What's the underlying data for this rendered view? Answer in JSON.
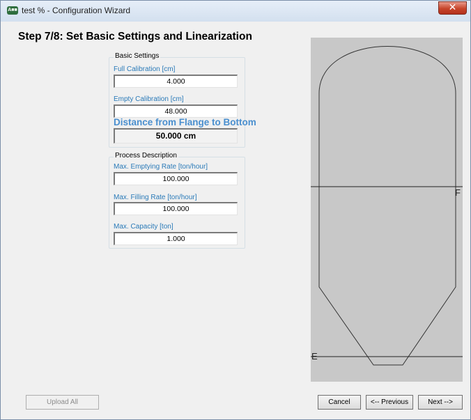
{
  "window": {
    "title": "test % - Configuration Wizard",
    "icon_text": "A■■",
    "close_icon": "✕"
  },
  "step_title": "Step 7/8: Set Basic Settings and Linearization",
  "basic_settings": {
    "legend": "Basic Settings",
    "full_calibration_label": "Full Calibration [cm]",
    "full_calibration_value": "4.000",
    "empty_calibration_label": "Empty Calibration [cm]",
    "empty_calibration_value": "48.000",
    "distance_label": "Distance from Flange to Bottom",
    "distance_value": "50.000 cm"
  },
  "process_description": {
    "legend": "Process Description",
    "max_emptying_label": "Max. Emptying Rate [ton/hour]",
    "max_emptying_value": "100.000",
    "max_filling_label": "Max. Filling Rate  [ton/hour]",
    "max_filling_value": "100.000",
    "max_capacity_label": "Max. Capacity [ton]",
    "max_capacity_value": "1.000"
  },
  "diagram": {
    "full_marker": "F",
    "empty_marker": "E"
  },
  "buttons": {
    "upload_all": "Upload All",
    "cancel": "Cancel",
    "previous": "<-- Previous",
    "next": "Next -->"
  }
}
